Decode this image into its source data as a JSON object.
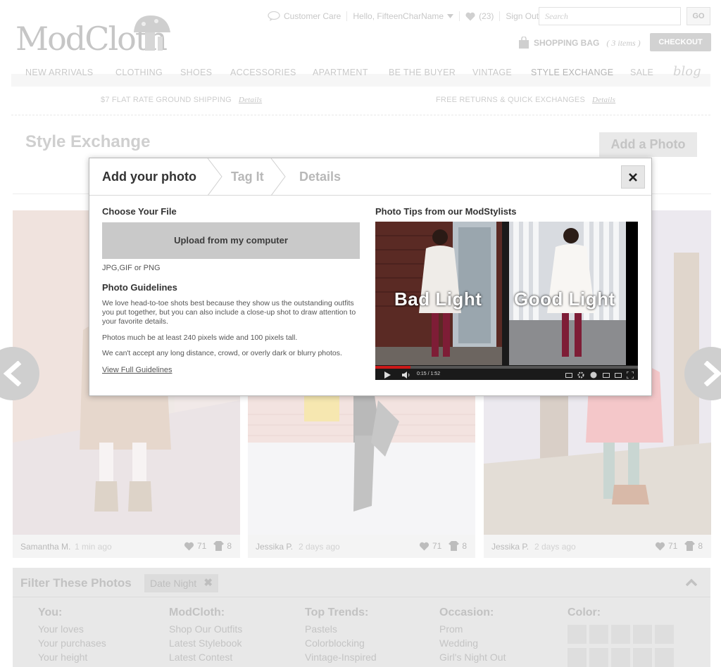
{
  "header": {
    "logo_text": "ModCloth",
    "utility": {
      "customer_care": "Customer Care",
      "greeting": "Hello, FifteenCharName",
      "loves_count": "(23)",
      "sign_out": "Sign Out"
    },
    "search": {
      "placeholder": "Search",
      "go_label": "GO"
    },
    "bag": {
      "label": "SHOPPING BAG",
      "count": "( 3 items )"
    },
    "checkout_label": "CHECKOUT"
  },
  "nav": {
    "items": [
      "NEW ARRIVALS",
      "CLOTHING",
      "SHOES",
      "ACCESSORIES",
      "APARTMENT",
      "BE THE BUYER",
      "VINTAGE",
      "STYLE EXCHANGE",
      "SALE"
    ],
    "active": "STYLE EXCHANGE",
    "blog_label": "blog"
  },
  "promos": [
    {
      "text": "$7 FLAT RATE GROUND SHIPPING",
      "link": "Details"
    },
    {
      "text": "FREE RETURNS & QUICK EXCHANGES",
      "link": "Details"
    }
  ],
  "page": {
    "title": "Style Exchange",
    "add_photo_label": "Add a Photo"
  },
  "cards": [
    {
      "name": "Samantha M.",
      "time": "1 min ago",
      "loves": "71",
      "shares": "8"
    },
    {
      "name": "Jessika P.",
      "time": "2 days ago",
      "loves": "71",
      "shares": "8"
    },
    {
      "name": "Jessika P.",
      "time": "2 days ago",
      "loves": "71",
      "shares": "8"
    }
  ],
  "filter": {
    "title": "Filter These Photos",
    "active_chip": "Date Night",
    "columns": [
      {
        "heading": "You:",
        "items": [
          "Your loves",
          "Your purchases",
          "Your height"
        ]
      },
      {
        "heading": "ModCloth:",
        "items": [
          "Shop Our Outfits",
          "Latest Stylebook",
          "Latest Contest"
        ]
      },
      {
        "heading": "Top Trends:",
        "items": [
          "Pastels",
          "Colorblocking",
          "Vintage-Inspired"
        ]
      },
      {
        "heading": "Occasion:",
        "items": [
          "Prom",
          "Wedding",
          "Girl's Night Out"
        ]
      }
    ],
    "color_heading": "Color:"
  },
  "modal": {
    "steps": [
      "Add your photo",
      "Tag It",
      "Details"
    ],
    "active_step": "Add your photo",
    "choose_heading": "Choose Your File",
    "upload_label": "Upload from my computer",
    "file_types": "JPG,GIF or PNG",
    "guidelines_heading": "Photo Guidelines",
    "guidelines_p1": "We love head-to-toe shots best because they show us the outstanding outfits you put together, but you can also include a close-up shot to draw attention to your favorite details.",
    "guidelines_p2": "Photos much be at least 240 pixels wide and 100 pixels tall.",
    "guidelines_p3": "We can't accept any long distance, crowd, or overly dark or blurry photos.",
    "guidelines_link": "View Full Guidelines",
    "tips_heading": "Photo Tips from our ModStylists",
    "video": {
      "caption_left": "Bad Light",
      "caption_right": "Good Light",
      "time": "0:15 / 1:52",
      "progress": 0.135
    }
  },
  "colors": {
    "modal_text": "#333333",
    "video_progress": "#cc1818",
    "faded_ui": "#c9c9c9"
  }
}
